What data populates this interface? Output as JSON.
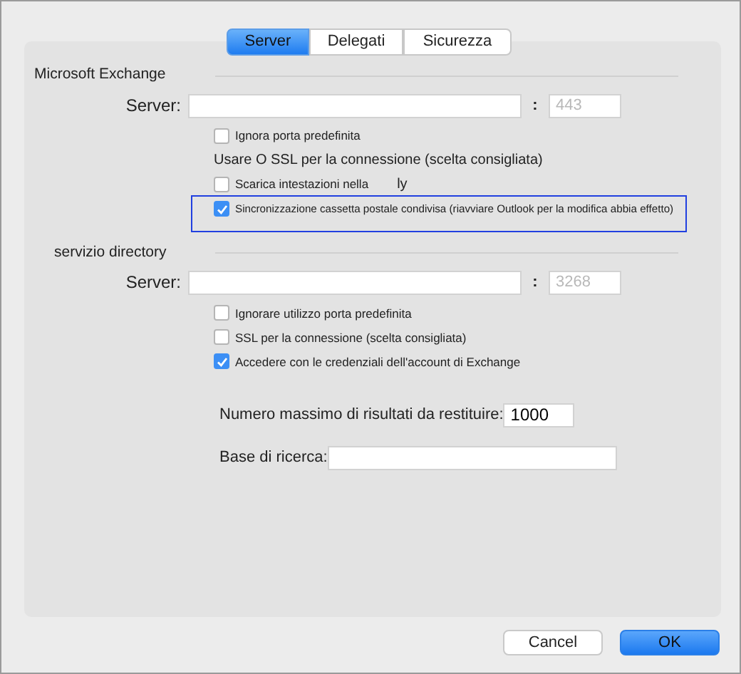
{
  "tabs": [
    {
      "label": "Server",
      "selected": true
    },
    {
      "label": "Delegati",
      "selected": false
    },
    {
      "label": "Sicurezza",
      "selected": false
    }
  ],
  "sections": [
    {
      "title": "Microsoft Exchange",
      "server_label": "Server:",
      "port_colon": ":",
      "port_placeholder": "443",
      "options": [
        {
          "kind": "checkbox",
          "label": "Ignora porta predefinita",
          "checked": false,
          "highlighted": false
        },
        {
          "kind": "text",
          "label": "Usare O SSL per la connessione (scelta consigliata)"
        },
        {
          "kind": "checkbox",
          "label": "Scarica intestazioni nella",
          "trailing": "ly",
          "checked": false,
          "highlighted": false
        },
        {
          "kind": "checkbox",
          "label": "Sincronizzazione cassetta postale condivisa (riavviare Outlook per la modifica abbia effetto)",
          "checked": true,
          "highlighted": true
        }
      ]
    },
    {
      "title": "servizio directory",
      "server_label": "Server:",
      "port_colon": ":",
      "port_placeholder": "3268",
      "options": [
        {
          "kind": "checkbox",
          "label": "Ignorare utilizzo porta predefinita",
          "checked": false,
          "highlighted": false
        },
        {
          "kind": "checkbox",
          "label": "SSL per la connessione (scelta consigliata)",
          "checked": false,
          "highlighted": false
        },
        {
          "kind": "checkbox",
          "label": "Accedere con le credenziali dell'account di Exchange",
          "checked": true,
          "highlighted": false
        }
      ]
    }
  ],
  "max_results": {
    "label": "Numero massimo di risultati da restituire:",
    "value": "1000"
  },
  "search_base": {
    "label": "Base di ricerca:"
  },
  "buttons": [
    {
      "label": "Cancel",
      "kind": "secondary"
    },
    {
      "label": "OK",
      "kind": "primary"
    }
  ]
}
